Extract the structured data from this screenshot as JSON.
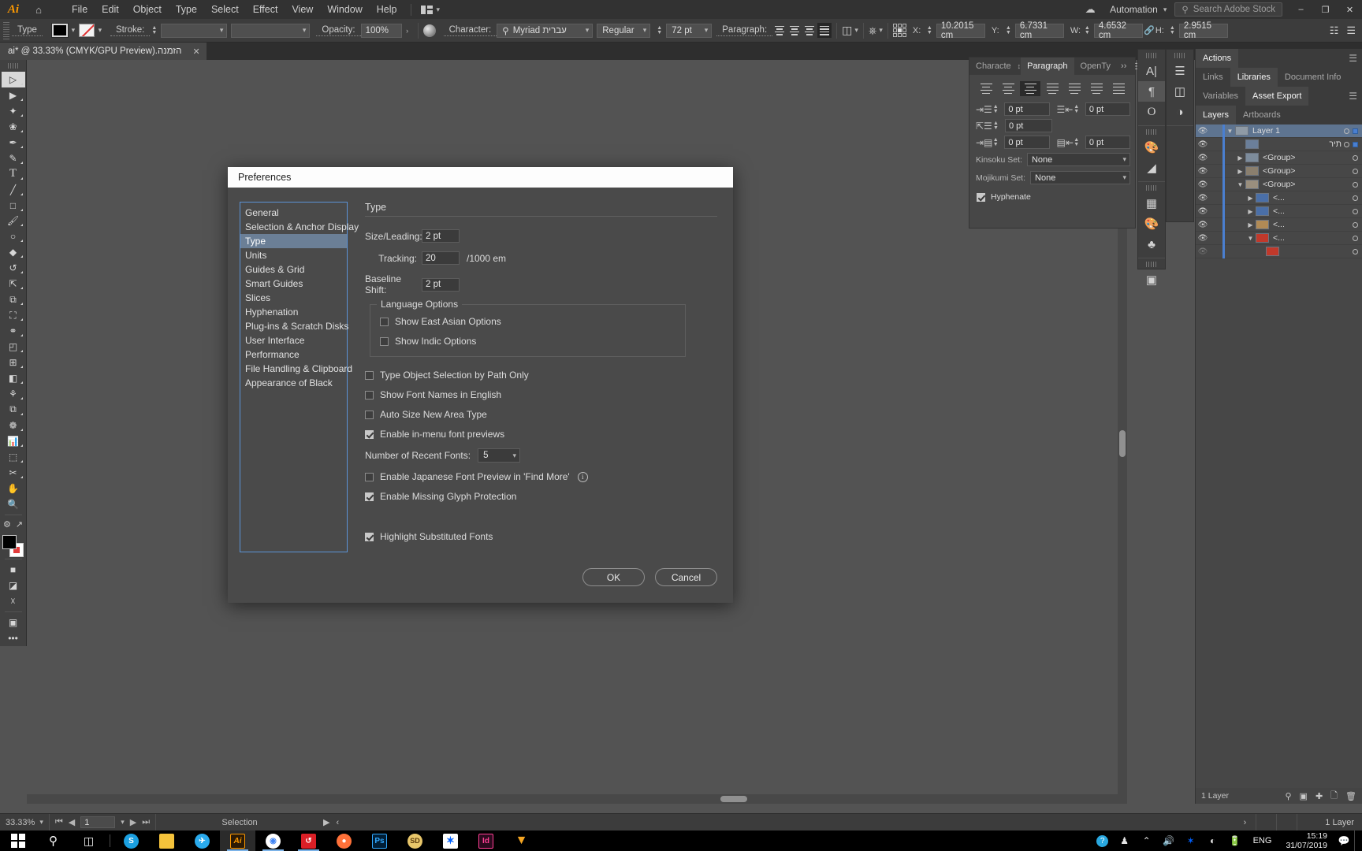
{
  "menubar": {
    "app_logo": "Ai",
    "home_icon": "home-icon",
    "items": [
      "File",
      "Edit",
      "Object",
      "Type",
      "Select",
      "Effect",
      "View",
      "Window",
      "Help"
    ],
    "automation_label": "Automation",
    "search_placeholder": "Search Adobe Stock",
    "search_icon": "search-icon",
    "cloud_icon": "cloud-icon",
    "minimize": "–",
    "maximize": "❐",
    "close": "✕"
  },
  "controlbar": {
    "type_label": "Type",
    "stroke_label": "Stroke:",
    "stroke_weight": "",
    "stroke_profile": "",
    "opacity_label": "Opacity:",
    "opacity_value": "100%",
    "opacity_arrow": "›",
    "character_label": "Character:",
    "font_family": "Myriad עברית",
    "font_style": "Regular",
    "font_size": "72 pt",
    "paragraph_label": "Paragraph:",
    "x_label": "X:",
    "x_value": "10.2015 cm",
    "y_label": "Y:",
    "y_value": "6.7331 cm",
    "w_label": "W:",
    "w_value": "4.6532 cm",
    "h_label": "H:",
    "h_value": "2.9515 cm",
    "link_icon": "link-icon"
  },
  "document": {
    "tab_title": "הזמנה.ai* @ 33.33% (CMYK/GPU Preview)",
    "tab_close": "✕"
  },
  "toolbar": {
    "tools": [
      {
        "name": "selection-tool",
        "glyph": "▷"
      },
      {
        "name": "direct-selection-tool",
        "glyph": "▶"
      },
      {
        "name": "magic-wand-tool",
        "glyph": "✦"
      },
      {
        "name": "lasso-tool",
        "glyph": "❀"
      },
      {
        "name": "pen-tool",
        "glyph": "✒"
      },
      {
        "name": "curvature-tool",
        "glyph": "✎"
      },
      {
        "name": "type-tool",
        "glyph": "T"
      },
      {
        "name": "line-segment-tool",
        "glyph": "╱"
      },
      {
        "name": "rectangle-tool",
        "glyph": "□"
      },
      {
        "name": "paintbrush-tool",
        "glyph": "὘C"
      },
      {
        "name": "shaper-tool",
        "glyph": "○"
      },
      {
        "name": "eraser-tool",
        "glyph": "◆"
      },
      {
        "name": "rotate-tool",
        "glyph": "↺"
      },
      {
        "name": "scale-tool",
        "glyph": "⤡"
      },
      {
        "name": "width-tool",
        "glyph": "⧉"
      },
      {
        "name": "free-transform-tool",
        "glyph": "⛶"
      },
      {
        "name": "shape-builder-tool",
        "glyph": "⬤"
      },
      {
        "name": "perspective-grid-tool",
        "glyph": "◰"
      },
      {
        "name": "mesh-tool",
        "glyph": "⊞"
      },
      {
        "name": "gradient-tool",
        "glyph": "◧"
      },
      {
        "name": "eyedropper-tool",
        "glyph": "☂"
      },
      {
        "name": "blend-tool",
        "glyph": "⧉"
      },
      {
        "name": "symbol-sprayer-tool",
        "glyph": "❁"
      },
      {
        "name": "column-graph-tool",
        "glyph": "ὌA"
      },
      {
        "name": "artboard-tool",
        "glyph": "⬚"
      },
      {
        "name": "slice-tool",
        "glyph": "✂"
      },
      {
        "name": "hand-tool",
        "glyph": "✋"
      },
      {
        "name": "zoom-tool",
        "glyph": "ὐD"
      }
    ],
    "fill_color": "#000000",
    "stroke_color": "#ffffff",
    "more_tools": "•••"
  },
  "dialog": {
    "title": "Preferences",
    "categories": [
      "General",
      "Selection & Anchor Display",
      "Type",
      "Units",
      "Guides & Grid",
      "Smart Guides",
      "Slices",
      "Hyphenation",
      "Plug-ins & Scratch Disks",
      "User Interface",
      "Performance",
      "File Handling & Clipboard",
      "Appearance of Black"
    ],
    "selected_category": "Type",
    "pane_title": "Type",
    "fields": [
      {
        "label": "Size/Leading:",
        "value": "2 pt",
        "suffix": "",
        "name": "size-leading"
      },
      {
        "label": "Tracking:",
        "value": "20",
        "suffix": "/1000 em",
        "name": "tracking"
      },
      {
        "label": "Baseline Shift:",
        "value": "2 pt",
        "suffix": "",
        "name": "baseline-shift"
      }
    ],
    "language_options_label": "Language Options",
    "language_checkboxes": [
      {
        "label": "Show East Asian Options",
        "checked": false,
        "name": "show-east-asian-options"
      },
      {
        "label": "Show Indic Options",
        "checked": false,
        "name": "show-indic-options"
      }
    ],
    "checkboxes": [
      {
        "label": "Type Object Selection by Path Only",
        "checked": false,
        "name": "type-object-selection-by-path-only"
      },
      {
        "label": "Show Font Names in English",
        "checked": false,
        "name": "show-font-names-in-english"
      },
      {
        "label": "Auto Size New Area Type",
        "checked": false,
        "name": "auto-size-new-area-type"
      },
      {
        "label": "Enable in-menu font previews",
        "checked": true,
        "name": "enable-in-menu-font-previews"
      }
    ],
    "recent_fonts_label": "Number of Recent Fonts:",
    "recent_fonts_value": "5",
    "checkboxes2": [
      {
        "label": "Enable Japanese Font Preview in 'Find More'",
        "checked": false,
        "name": "enable-japanese-font-preview",
        "info": true
      },
      {
        "label": "Enable Missing Glyph Protection",
        "checked": true,
        "name": "enable-missing-glyph-protection"
      }
    ],
    "highlight_substituted": {
      "label": "Highlight Substituted Fonts",
      "checked": true,
      "name": "highlight-substituted-fonts"
    },
    "ok_label": "OK",
    "cancel_label": "Cancel"
  },
  "paragraph_panel": {
    "tabs": [
      "Characte",
      "Paragraph",
      "OpenTy"
    ],
    "active_tab": "Paragraph",
    "indent_left": "0 pt",
    "indent_right": "0 pt",
    "space_before": "0 pt",
    "space_after": "0 pt",
    "indent_first": "0 pt",
    "kinsoku_label": "Kinsoku Set:",
    "kinsoku_value": "None",
    "mojikumi_label": "Mojikumi Set:",
    "mojikumi_value": "None",
    "hyphenate_label": "Hyphenate",
    "hyphenate_checked": true
  },
  "right_panel": {
    "tabs_row1": [
      "Actions"
    ],
    "tabs_row2": [
      "Links",
      "Libraries",
      "Document Info"
    ],
    "tabs_row3": [
      "Variables",
      "Asset Export"
    ],
    "tabs_row4": [
      "Layers",
      "Artboards"
    ],
    "active_tab_row2": "Libraries",
    "active_tab_row3": "Asset Export",
    "active_tab_row4": "Layers",
    "layers": [
      {
        "name": "Layer 1",
        "indent": 0,
        "expanded": true,
        "selected": true,
        "eye": true
      },
      {
        "name": "תיר",
        "indent": 1,
        "expanded": false,
        "selected": false,
        "eye": true
      },
      {
        "name": "<Group>",
        "indent": 1,
        "expanded": false,
        "selected": false,
        "eye": true
      },
      {
        "name": "<Group>",
        "indent": 1,
        "expanded": false,
        "selected": false,
        "eye": true
      },
      {
        "name": "<Group>",
        "indent": 1,
        "expanded": true,
        "selected": false,
        "eye": true
      },
      {
        "name": "<...",
        "indent": 2,
        "expanded": false,
        "selected": false,
        "eye": true
      },
      {
        "name": "<...",
        "indent": 2,
        "expanded": false,
        "selected": false,
        "eye": true
      },
      {
        "name": "<...",
        "indent": 2,
        "expanded": false,
        "selected": false,
        "eye": true
      },
      {
        "name": "<...",
        "indent": 2,
        "expanded": true,
        "selected": false,
        "eye": true
      },
      {
        "name": "",
        "indent": 3,
        "expanded": false,
        "selected": false,
        "eye": false
      }
    ],
    "footer_count": "1 Layer"
  },
  "statusbar": {
    "zoom": "33.33%",
    "page": "1",
    "status_text": "Selection",
    "first_page": "⏮",
    "prev_page": "◀",
    "next_page": "▶",
    "last_page": "⏭",
    "play": "▶",
    "expand": "‹"
  },
  "taskbar": {
    "start_icon": "windows-start-icon",
    "search_icon": "search-icon",
    "taskview_icon": "task-view-icon",
    "apps": [
      {
        "name": "skype-icon",
        "label": "S",
        "bg": "#1ba0e1",
        "color": "#ffffff",
        "round": true,
        "running": false
      },
      {
        "name": "file-explorer-icon",
        "label": "",
        "bg": "#f5c33b",
        "color": "#333333",
        "round": false,
        "running": false
      },
      {
        "name": "telegram-icon",
        "label": "✈",
        "bg": "#2aabee",
        "color": "#ffffff",
        "round": true,
        "running": false
      },
      {
        "name": "illustrator-icon",
        "label": "Ai",
        "bg": "#2b1a05",
        "color": "#ff9a00",
        "round": false,
        "running": true
      },
      {
        "name": "chrome-icon",
        "label": "",
        "bg": "#ffffff",
        "color": "#4285f4",
        "round": true,
        "running": true
      },
      {
        "name": "creative-cloud-icon",
        "label": "",
        "bg": "#da1f26",
        "color": "#ffffff",
        "round": false,
        "running": true
      },
      {
        "name": "firefox-icon",
        "label": "",
        "bg": "#ff7139",
        "color": "#ffffff",
        "round": true,
        "running": false
      },
      {
        "name": "photoshop-icon",
        "label": "Ps",
        "bg": "#001e36",
        "color": "#31a8ff",
        "round": false,
        "running": false
      },
      {
        "name": "soda-pdf-icon",
        "label": "SD",
        "bg": "#e8c66a",
        "color": "#5a3a0a",
        "round": true,
        "running": false
      },
      {
        "name": "dropbox-icon",
        "label": "",
        "bg": "#ffffff",
        "color": "#0061ff",
        "round": false,
        "running": false
      },
      {
        "name": "indesign-icon",
        "label": "Id",
        "bg": "#2b0a1e",
        "color": "#ff3f94",
        "round": false,
        "running": false
      },
      {
        "name": "wondershare-icon",
        "label": "▼",
        "bg": "transparent",
        "color": "#f5a623",
        "round": false,
        "running": false
      }
    ],
    "tray": [
      {
        "name": "help-notification-icon",
        "glyph": "?"
      },
      {
        "name": "people-icon",
        "glyph": "὆5"
      },
      {
        "name": "show-hidden-icons-icon",
        "glyph": "⌃"
      },
      {
        "name": "volume-icon",
        "glyph": "ὐA"
      },
      {
        "name": "dropbox-tray-icon",
        "glyph": "❖"
      },
      {
        "name": "wifi-icon",
        "glyph": "◠"
      },
      {
        "name": "battery-icon",
        "glyph": "ὐB"
      }
    ],
    "language": "ENG",
    "time": "15:19",
    "date": "31/07/2019",
    "action_center_icon": "notification-icon"
  }
}
